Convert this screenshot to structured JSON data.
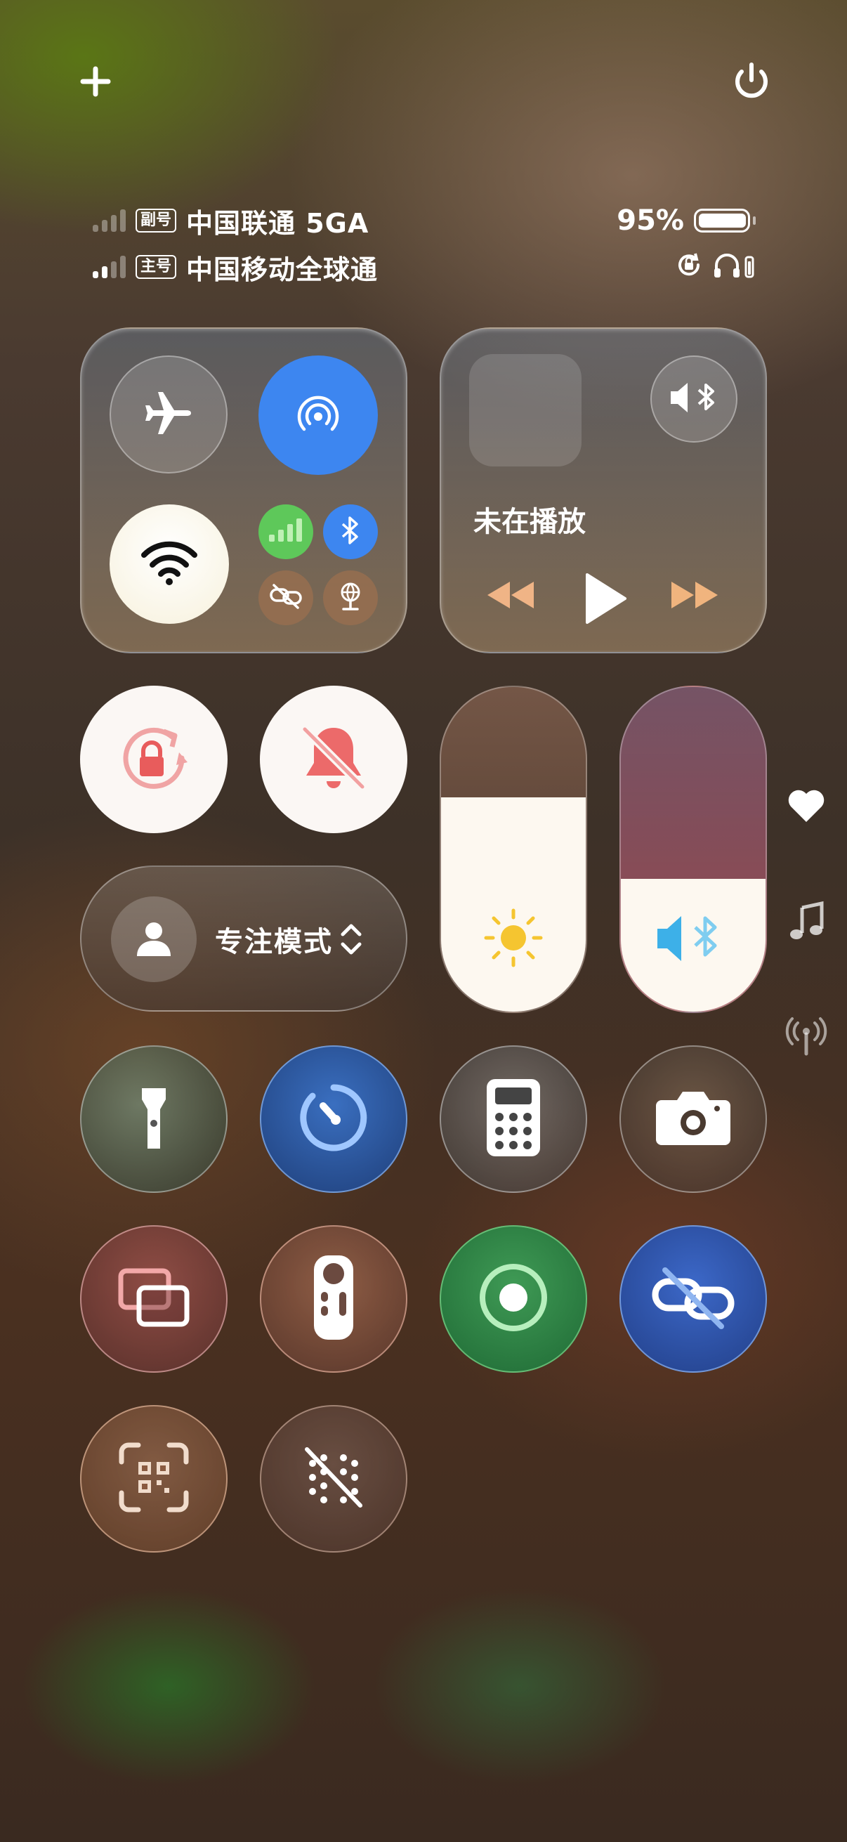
{
  "top_bar": {
    "add_icon": "plus-icon",
    "power_icon": "power-icon"
  },
  "carriers": [
    {
      "badge": "副号",
      "name": "中国联通 5GA",
      "signal_bars": 0
    },
    {
      "badge": "主号",
      "name": "中国移动全球通",
      "signal_bars": 2
    }
  ],
  "battery": {
    "percent_text": "95%",
    "level": 0.95
  },
  "status_icons": [
    "rotation-lock-icon",
    "headphones-battery-icon"
  ],
  "connectivity": {
    "airplane": {
      "icon": "airplane-icon",
      "on": false
    },
    "airdrop": {
      "icon": "airdrop-icon",
      "on": true,
      "color": "#3d86f0"
    },
    "wifi": {
      "icon": "wifi-icon",
      "on": true
    },
    "cellular": {
      "icon": "cellular-icon",
      "on": true,
      "color": "#5ec85a"
    },
    "bluetooth": {
      "icon": "bluetooth-icon",
      "on": true,
      "color": "#3d86f0"
    },
    "link": {
      "icon": "link-off-icon",
      "on": false
    },
    "hotspot": {
      "icon": "globe-hotspot-icon",
      "on": false
    }
  },
  "media": {
    "status": "未在播放",
    "output_icon": "speaker-bluetooth-icon"
  },
  "brightness": {
    "level": 0.66,
    "icon": "sun-icon",
    "icon_color": "#f5c530"
  },
  "volume": {
    "level": 0.41,
    "icon": "speaker-bluetooth-icon",
    "icon_color": "#3db0e8"
  },
  "rotation_lock": {
    "icon": "rotation-lock-icon",
    "color": "#e85c5c"
  },
  "silent": {
    "icon": "bell-slash-icon",
    "color": "#e85c5c"
  },
  "focus": {
    "label": "专注模式",
    "icon": "person-icon"
  },
  "grid": [
    {
      "name": "flashlight",
      "icon": "flashlight-icon"
    },
    {
      "name": "timer",
      "icon": "timer-icon"
    },
    {
      "name": "calculator",
      "icon": "calculator-icon"
    },
    {
      "name": "camera",
      "icon": "camera-icon"
    },
    {
      "name": "screen-mirroring",
      "icon": "screen-mirroring-icon"
    },
    {
      "name": "remote",
      "icon": "remote-icon"
    },
    {
      "name": "screen-record",
      "icon": "record-icon"
    },
    {
      "name": "link",
      "icon": "link-off-icon"
    },
    {
      "name": "qr-scanner",
      "icon": "qr-code-icon"
    },
    {
      "name": "dots-off",
      "icon": "dots-slash-icon"
    }
  ],
  "side_icons": [
    "heart-icon",
    "music-note-icon",
    "antenna-icon"
  ]
}
